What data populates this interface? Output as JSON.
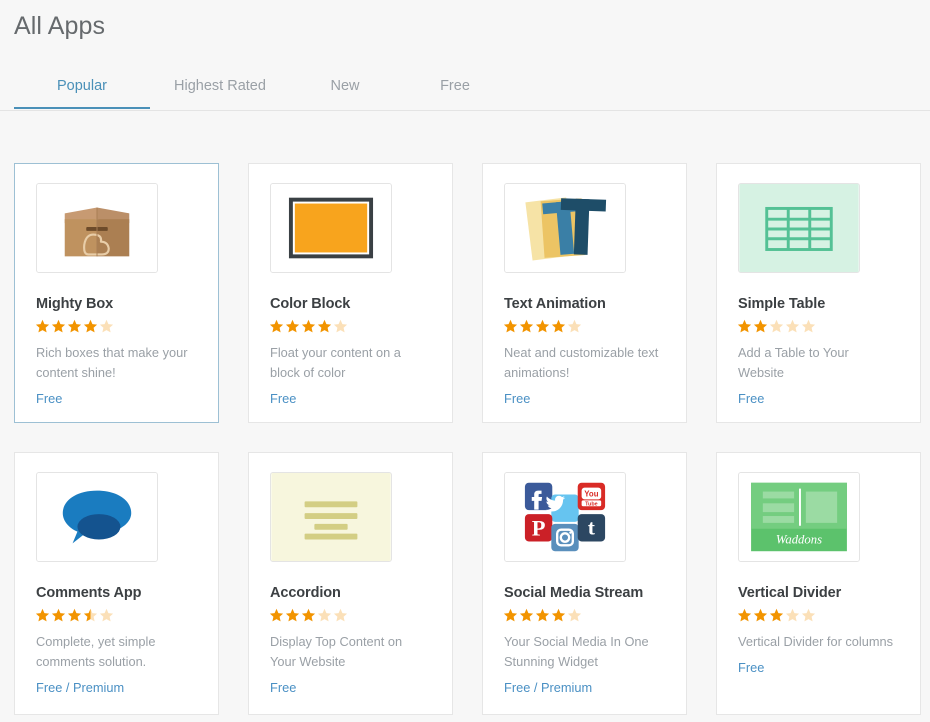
{
  "header": {
    "title": "All Apps"
  },
  "tabs": [
    {
      "label": "Popular",
      "active": true
    },
    {
      "label": "Highest Rated",
      "active": false
    },
    {
      "label": "New",
      "active": false
    },
    {
      "label": "Free",
      "active": false
    }
  ],
  "colors": {
    "accent": "#4a90b8",
    "link": "#4a90c4",
    "star_filled": "#f29400",
    "star_empty": "#fbe0b8",
    "page_bg": "#f7f7f7",
    "card_bg": "#ffffff",
    "card_border": "#e6e6e6",
    "card_border_selected": "#9dc0d4",
    "title_text": "#666a6d",
    "name_text": "#3c4043",
    "desc_text": "#9aa0a6",
    "tab_inactive": "#9aa0a6"
  },
  "apps": [
    {
      "name": "Mighty Box",
      "rating": 4,
      "rating_label": "4 out of 5 stars",
      "description": "Rich boxes that make your content shine!",
      "price": "Free",
      "icon": "mighty-box-icon",
      "selected": true
    },
    {
      "name": "Color Block",
      "rating": 4,
      "rating_label": "4 out of 5 stars",
      "description": "Float your content on a block of color",
      "price": "Free",
      "icon": "color-block-icon",
      "selected": false
    },
    {
      "name": "Text Animation",
      "rating": 4,
      "rating_label": "4 out of 5 stars",
      "description": "Neat and customizable text animations!",
      "price": "Free",
      "icon": "text-animation-icon",
      "selected": false
    },
    {
      "name": "Simple Table",
      "rating": 2,
      "rating_label": "2 out of 5 stars",
      "description": "Add a Table to Your Website",
      "price": "Free",
      "icon": "simple-table-icon",
      "selected": false
    },
    {
      "name": "Comments App",
      "rating": 3.5,
      "rating_label": "3.5 out of 5 stars",
      "description": "Complete, yet simple comments solution.",
      "price": "Free / Premium",
      "icon": "comments-app-icon",
      "selected": false
    },
    {
      "name": "Accordion",
      "rating": 3,
      "rating_label": "3 out of 5 stars",
      "description": "Display Top Content on Your Website",
      "price": "Free",
      "icon": "accordion-icon",
      "selected": false
    },
    {
      "name": "Social Media Stream",
      "rating": 4,
      "rating_label": "4 out of 5 stars",
      "description": "Your Social Media In One Stunning Widget",
      "price": "Free / Premium",
      "icon": "social-media-stream-icon",
      "selected": false
    },
    {
      "name": "Vertical Divider",
      "rating": 3,
      "rating_label": "3 out of 5 stars",
      "description": "Vertical Divider for columns",
      "price": "Free",
      "icon": "vertical-divider-icon",
      "badge_text": "Waddons",
      "selected": false
    }
  ]
}
